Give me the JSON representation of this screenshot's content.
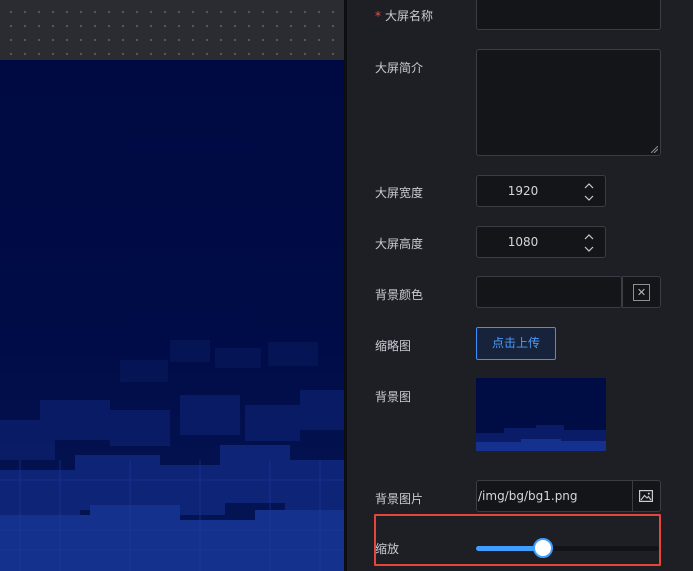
{
  "form": {
    "name": {
      "required_mark": "*",
      "label": "大屏名称",
      "value": ""
    },
    "description": {
      "label": "大屏简介",
      "value": ""
    },
    "width": {
      "label": "大屏宽度",
      "value": "1920"
    },
    "height": {
      "label": "大屏高度",
      "value": "1080"
    },
    "background_color": {
      "label": "背景颜色",
      "value": "",
      "clear_icon": "close-icon"
    },
    "thumbnail": {
      "label": "缩略图",
      "upload_label": "点击上传"
    },
    "background_image": {
      "label": "背景图"
    },
    "background_image_path": {
      "label": "背景图片",
      "value": "/img/bg/bg1.png",
      "icon": "image-icon"
    },
    "scale": {
      "label": "缩放",
      "value_fraction": 0.36
    }
  },
  "colors": {
    "accent": "#409eff",
    "highlight_border": "#e5453b",
    "required": "#e5534b",
    "canvas_bg": "#000c44"
  }
}
